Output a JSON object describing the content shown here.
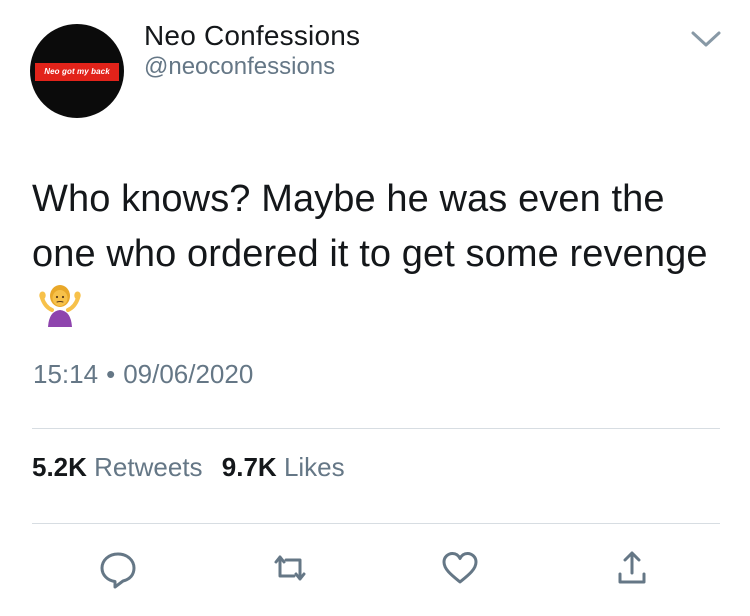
{
  "author": {
    "display_name": "Neo Confessions",
    "handle": "@neoconfessions",
    "avatar_badge_text": "Neo got my back",
    "avatar_badge_color": "#e2231a",
    "avatar_bg_color": "#0b0b0b"
  },
  "tweet": {
    "text": "Who knows? Maybe he was even the one who ordered it to get some revenge",
    "emoji": "person-shrugging-emoji",
    "time": "15:14",
    "date": "09/06/2020",
    "separator": "•"
  },
  "stats": {
    "retweets_count": "5.2K",
    "retweets_label": "Retweets",
    "likes_count": "9.7K",
    "likes_label": "Likes"
  },
  "icons": {
    "menu": "chevron-down-icon",
    "reply": "reply-icon",
    "retweet": "retweet-icon",
    "like": "heart-icon",
    "share": "share-icon"
  },
  "colors": {
    "text_primary": "#14171a",
    "text_secondary": "#657786",
    "accent": "#1da1f2",
    "icon_gray": "#657786",
    "divider": "#d7dde2"
  }
}
